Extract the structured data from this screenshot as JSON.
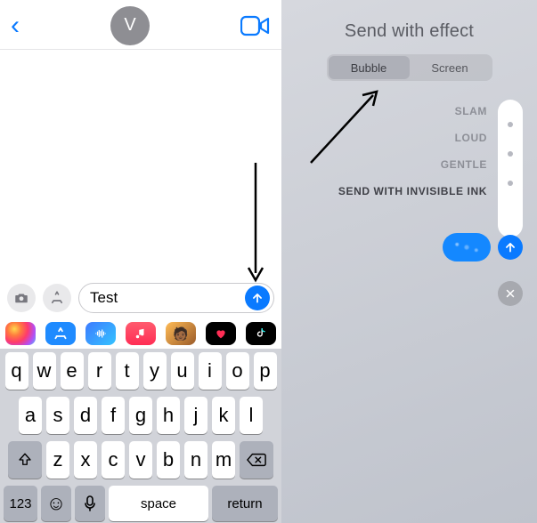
{
  "left": {
    "avatar_initial": "V",
    "composer": {
      "text": "Test"
    },
    "tray_icons": [
      "photos-icon",
      "appstore-icon",
      "audio-wave-icon",
      "music-icon",
      "memoji-icon",
      "heart-icon",
      "tiktok-icon"
    ],
    "keyboard": {
      "row1": [
        "q",
        "w",
        "e",
        "r",
        "t",
        "y",
        "u",
        "i",
        "o",
        "p"
      ],
      "row2": [
        "a",
        "s",
        "d",
        "f",
        "g",
        "h",
        "j",
        "k",
        "l"
      ],
      "row3": [
        "z",
        "x",
        "c",
        "v",
        "b",
        "n",
        "m"
      ],
      "numbers_label": "123",
      "space_label": "space",
      "return_label": "return"
    }
  },
  "right": {
    "title": "Send with effect",
    "segments": {
      "bubble": "Bubble",
      "screen": "Screen",
      "active": "bubble"
    },
    "effects": {
      "slam": "SLAM",
      "loud": "LOUD",
      "gentle": "GENTLE",
      "invisible": "SEND WITH INVISIBLE INK"
    }
  },
  "colors": {
    "accent": "#0a7aff"
  }
}
